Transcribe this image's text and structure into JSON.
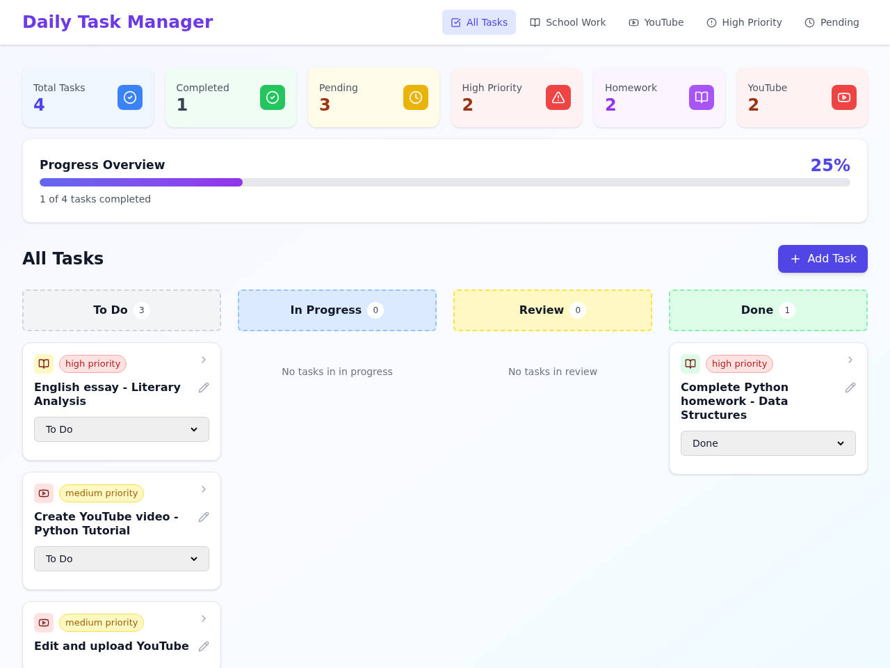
{
  "header": {
    "title": "Daily Task Manager",
    "nav": [
      {
        "label": "All Tasks",
        "selected": true
      },
      {
        "label": "School Work",
        "selected": false
      },
      {
        "label": "YouTube",
        "selected": false
      },
      {
        "label": "High Priority",
        "selected": false
      },
      {
        "label": "Pending",
        "selected": false
      }
    ]
  },
  "stats": [
    {
      "label": "Total Tasks",
      "value": "4"
    },
    {
      "label": "Completed",
      "value": "1"
    },
    {
      "label": "Pending",
      "value": "3"
    },
    {
      "label": "High Priority",
      "value": "2"
    },
    {
      "label": "Homework",
      "value": "2"
    },
    {
      "label": "YouTube",
      "value": "2"
    }
  ],
  "progress": {
    "title": "Progress Overview",
    "percent": "25%",
    "level": 0.25,
    "caption": "1 of 4 tasks completed"
  },
  "tasks_section": {
    "title": "All Tasks",
    "add_button": "Add Task"
  },
  "columns": [
    {
      "title": "To Do",
      "count": "3",
      "kind": "todo",
      "tasks": [
        {
          "kind": "school",
          "title": "English essay - Literary Analysis",
          "priority": "high priority",
          "color": "#fee2e2",
          "status": "To Do"
        },
        {
          "kind": "youtube",
          "title": "Create YouTube video - Python Tutorial",
          "priority": "medium priority",
          "color": "#fef9c3",
          "status": "To Do"
        },
        {
          "kind": "youtube",
          "title": "Edit and upload YouTube",
          "priority": "medium priority",
          "color": "#fef9c3"
        }
      ]
    },
    {
      "title": "In Progress",
      "count": "0",
      "kind": "progress",
      "empty": "No tasks in in progress"
    },
    {
      "title": "Review",
      "count": "0",
      "kind": "review",
      "empty": "No tasks in review"
    },
    {
      "title": "Done",
      "count": "1",
      "kind": "done",
      "tasks": [
        {
          "kind": "school",
          "title": "Complete Python homework - Data Structures",
          "priority": "high priority",
          "color": "#fee2e2",
          "status": "Done"
        }
      ]
    }
  ]
}
